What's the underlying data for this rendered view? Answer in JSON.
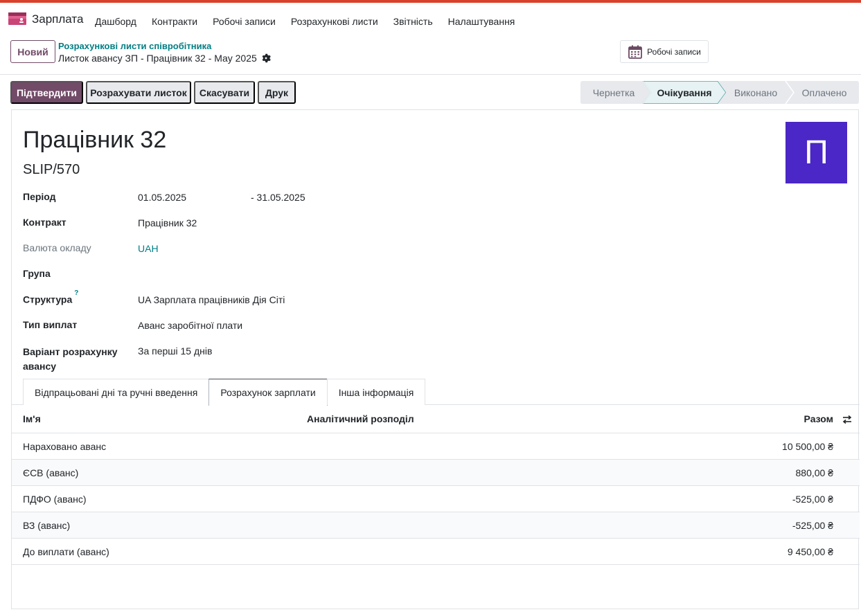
{
  "app": {
    "name": "Зарплата",
    "icon": "payroll-app-icon"
  },
  "menu": [
    "Дашборд",
    "Контракти",
    "Робочі записи",
    "Розрахункові листи",
    "Звітність",
    "Налаштування"
  ],
  "control": {
    "new_label": "Новий",
    "breadcrumb_parent": "Розрахункові листи співробітника",
    "breadcrumb_current": "Листок авансу ЗП - Працівник 32 - May 2025",
    "worktime_label": "Робочі записи"
  },
  "actions": {
    "confirm": "Підтвердити",
    "compute": "Розрахувати листок",
    "cancel": "Скасувати",
    "print": "Друк"
  },
  "stages": {
    "items": [
      "Чернетка",
      "Очікування",
      "Виконано",
      "Оплачено"
    ],
    "active": "Очікування"
  },
  "record": {
    "employee": "Працівник 32",
    "number": "SLIP/570",
    "avatar_letter": "П",
    "avatar_color": "#4a27c6"
  },
  "fields": {
    "period_label": "Період",
    "period_from": "01.05.2025",
    "period_to": "- 31.05.2025",
    "contract_label": "Контракт",
    "contract_value": "Працівник 32",
    "currency_label": "Валюта окладу",
    "currency_value": "UAH",
    "group_label": "Група",
    "structure_label": "Структура",
    "structure_help": "?",
    "structure_value": "UA Зарплата працівників Дія Сіті",
    "paytype_label": "Тип виплат",
    "paytype_value": "Аванс заробітної плати",
    "variant_label_1": "Варіант розрахунку",
    "variant_label_2": "авансу",
    "variant_value": "За перші 15 днів"
  },
  "tabs": [
    "Відпрацьовані дні та ручні введення",
    "Розрахунок зарплати",
    "Інша інформація"
  ],
  "active_tab": "Розрахунок зарплати",
  "lines": {
    "headers": {
      "name": "Ім'я",
      "analytic": "Аналітичний розподіл",
      "total": "Разом"
    },
    "rows": [
      {
        "name": "Нараховано аванс",
        "total": "10 500,00 ₴"
      },
      {
        "name": "ЄСВ (аванс)",
        "total": "880,00 ₴"
      },
      {
        "name": "ПДФО (аванс)",
        "total": "-525,00 ₴"
      },
      {
        "name": "ВЗ (аванс)",
        "total": "-525,00 ₴"
      },
      {
        "name": "До виплати (аванс)",
        "total": "9 450,00 ₴"
      }
    ]
  },
  "colors": {
    "primary": "#714b67",
    "link": "#017e84",
    "top_strip": "#d9412c"
  }
}
